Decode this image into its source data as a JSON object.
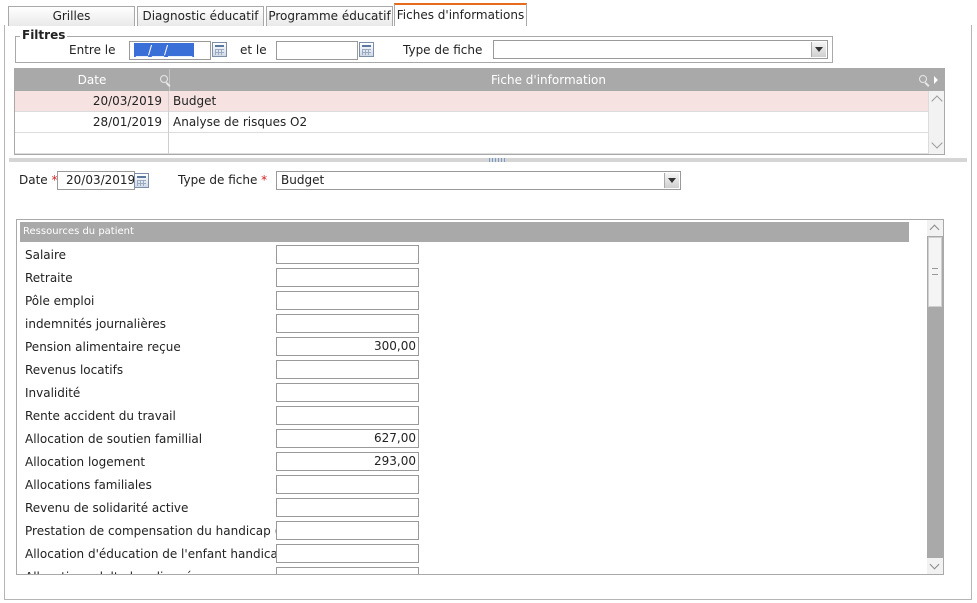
{
  "tabs": [
    {
      "label": "Grilles"
    },
    {
      "label": "Diagnostic éducatif"
    },
    {
      "label": "Programme éducatif"
    },
    {
      "label": "Fiches d'informations",
      "active": true
    }
  ],
  "filters": {
    "legend": "Filtres",
    "from_label": "Entre le",
    "from_value": "__/__/____",
    "to_label": "et le",
    "to_value": "",
    "type_label": "Type de fiche",
    "type_value": ""
  },
  "grid": {
    "columns": [
      "Date",
      "Fiche d'information"
    ],
    "rows": [
      {
        "date": "20/03/2019",
        "name": "Budget",
        "selected": true
      },
      {
        "date": "28/01/2019",
        "name": "Analyse de risques O2"
      },
      {
        "date": "",
        "name": ""
      }
    ]
  },
  "detail": {
    "date_label": "Date",
    "date_value": "20/03/2019",
    "type_label": "Type de fiche",
    "type_value": "Budget",
    "required_mark": "*"
  },
  "section": {
    "title": "Ressources du patient",
    "fields": [
      {
        "label": "Salaire",
        "value": ""
      },
      {
        "label": "Retraite",
        "value": ""
      },
      {
        "label": "Pôle emploi",
        "value": ""
      },
      {
        "label": "indemnités journalières",
        "value": ""
      },
      {
        "label": "Pension alimentaire reçue",
        "value": "300,00"
      },
      {
        "label": "Revenus locatifs",
        "value": ""
      },
      {
        "label": "Invalidité",
        "value": ""
      },
      {
        "label": "Rente accident du travail",
        "value": ""
      },
      {
        "label": "Allocation de soutien famillial",
        "value": "627,00"
      },
      {
        "label": "Allocation logement",
        "value": "293,00"
      },
      {
        "label": "Allocations familiales",
        "value": ""
      },
      {
        "label": "Revenu de solidarité active",
        "value": ""
      },
      {
        "label": "Prestation de compensation du handicap (AC",
        "value": ""
      },
      {
        "label": "Allocation d'éducation de l'enfant handicapé",
        "value": ""
      },
      {
        "label": "Allocation adulte handicapé",
        "value": ""
      }
    ]
  },
  "colors": {
    "active_tab_accent": "#e86a1d",
    "header_gray": "#a9a9a9",
    "selected_row": "#f6e3e1",
    "required": "#d21f1f"
  }
}
